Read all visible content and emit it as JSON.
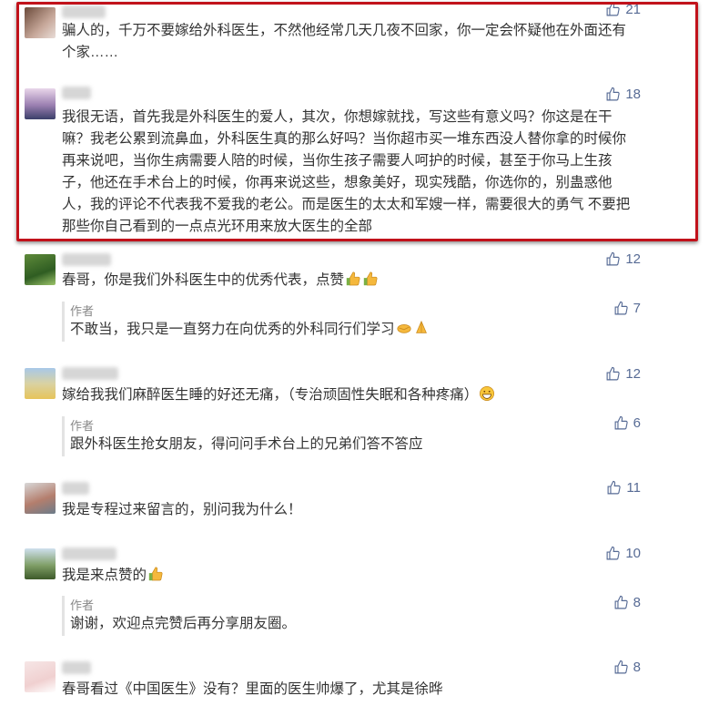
{
  "reply_author_label": "作者",
  "comments": [
    {
      "likes": "21",
      "text": "骗人的，千万不要嫁给外科医生，不然他经常几天几夜不回家，你一定会怀疑他在外面还有个家……"
    },
    {
      "likes": "18",
      "text": "我很无语，首先我是外科医生的爱人，其次，你想嫁就找，写这些有意义吗？你这是在干嘛？我老公累到流鼻血，外科医生真的那么好吗？当你超市买一堆东西没人替你拿的时候你再来说吧，当你生病需要人陪的时候，当你生孩子需要人呵护的时候，甚至于你马上生孩子，他还在手术台上的时候，你再来说这些，想象美好，现实残酷，你选你的，别蛊惑他人，我的评论不代表我不爱我的老公。而是医生的太太和军嫂一样，需要很大的勇气 不要把那些你自己看到的一点点光环用来放大医生的全部"
    },
    {
      "likes": "12",
      "text": "春哥，你是我们外科医生中的优秀代表，点赞",
      "reply": {
        "likes": "7",
        "text": "不敢当，我只是一直努力在向优秀的外科同行们学习"
      }
    },
    {
      "likes": "12",
      "text": "嫁给我我们麻醉医生睡的好还无痛，（专治顽固性失眠和各种疼痛）",
      "reply": {
        "likes": "6",
        "text": "跟外科医生抢女朋友，得问问手术台上的兄弟们答不答应"
      }
    },
    {
      "likes": "11",
      "text": "我是专程过来留言的，别问我为什么！"
    },
    {
      "likes": "10",
      "text": "我是来点赞的",
      "reply": {
        "likes": "8",
        "text": "谢谢，欢迎点完赞后再分享朋友圈。"
      }
    },
    {
      "likes": "8",
      "text": "春哥看过《中国医生》没有？里面的医生帅爆了，尤其是徐晔"
    }
  ]
}
